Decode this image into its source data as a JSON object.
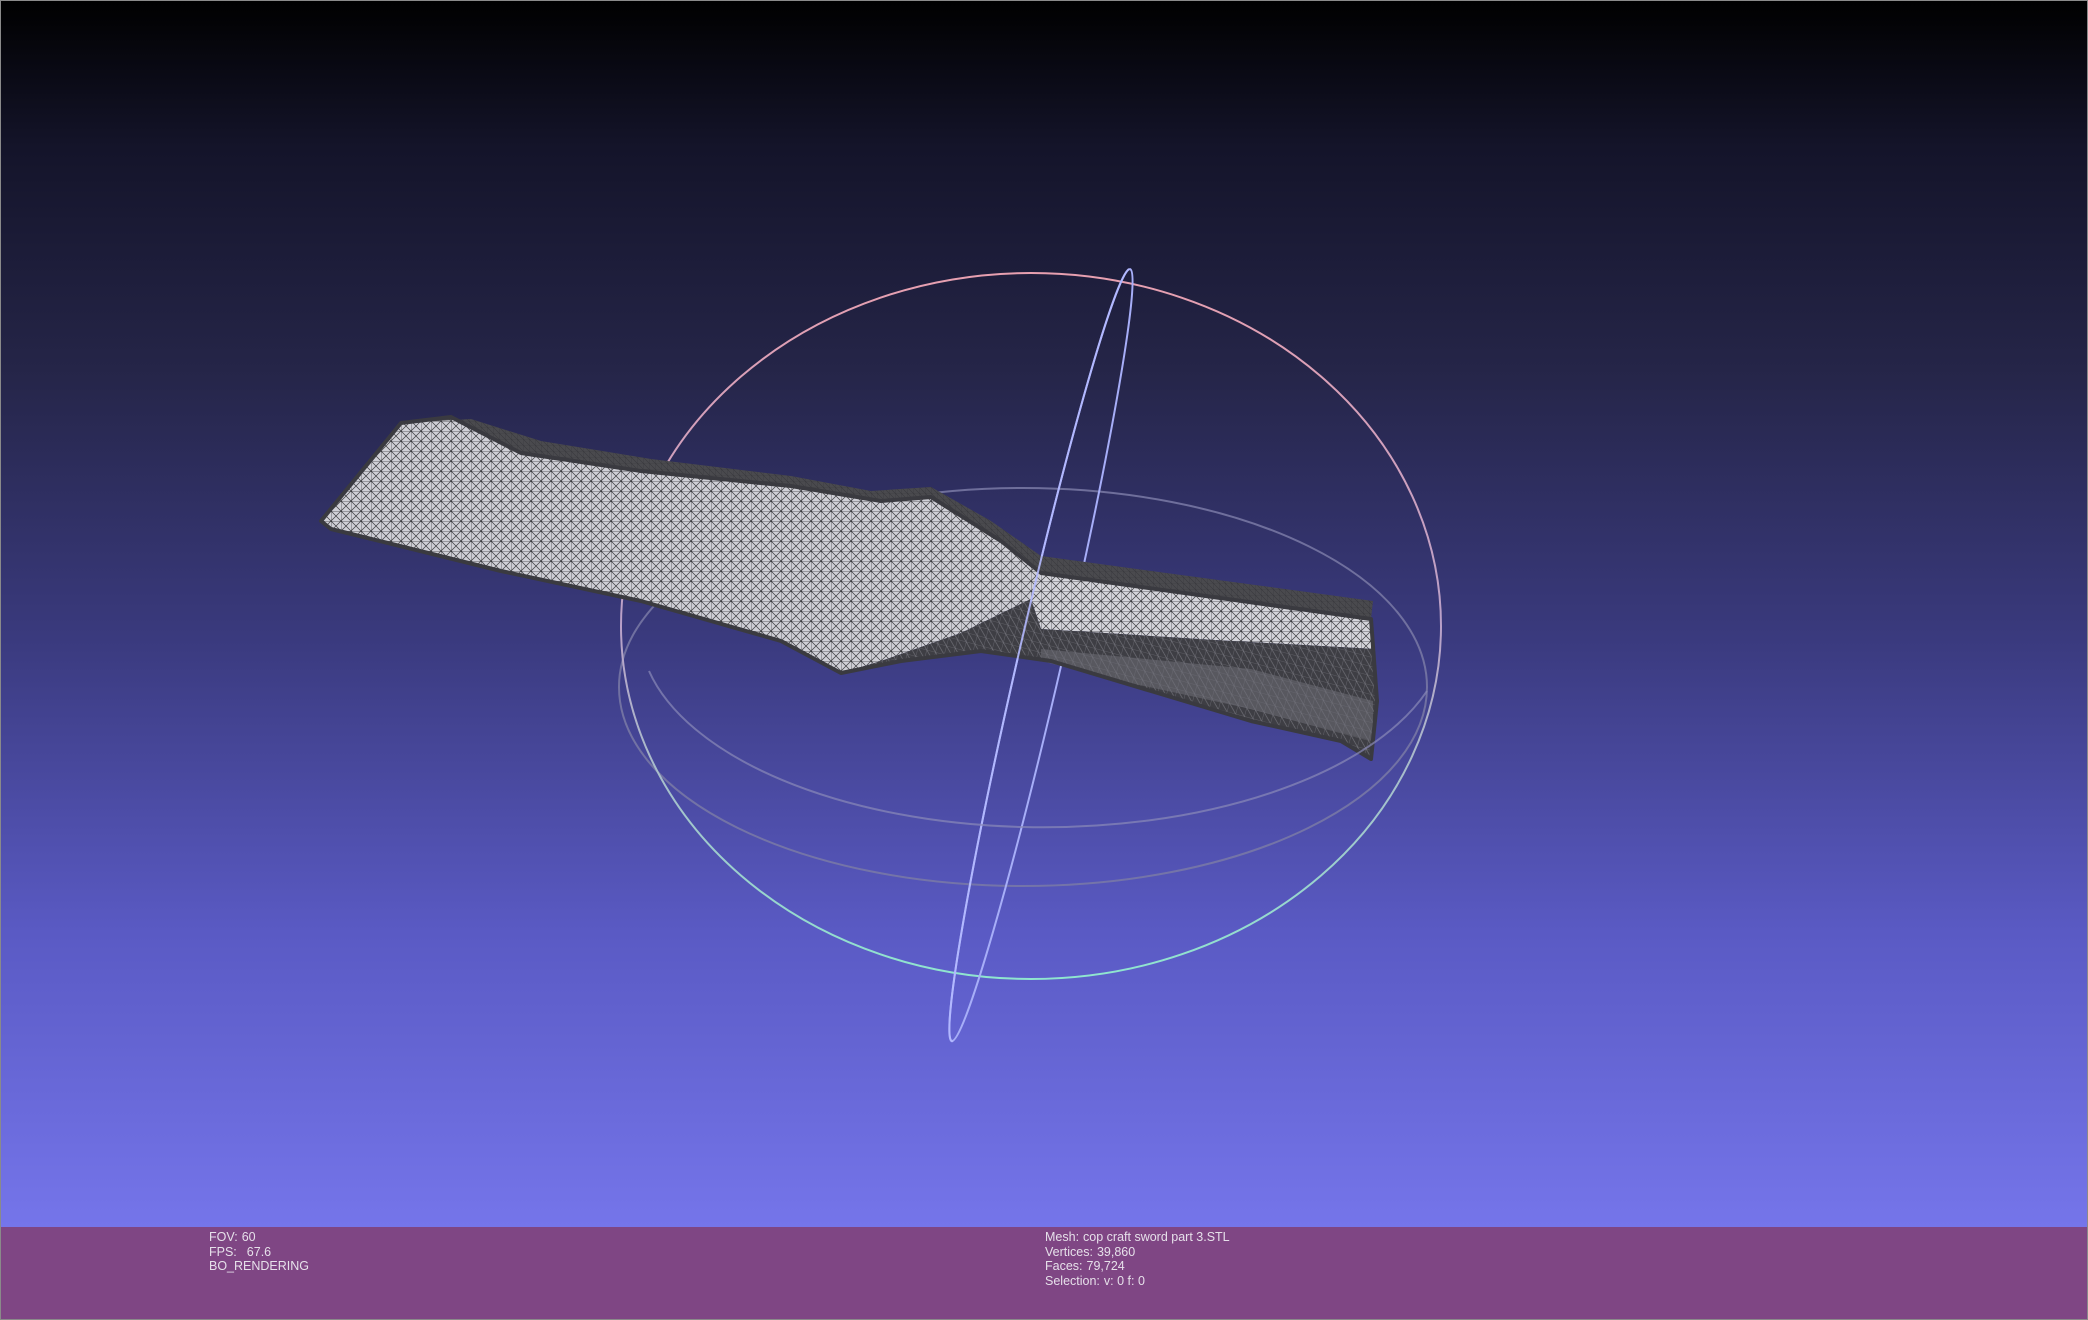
{
  "render_info": {
    "fov_label": "FOV:",
    "fov_value": "60",
    "fps_label": "FPS:",
    "fps_value": "67.6",
    "render_mode": "BO_RENDERING"
  },
  "mesh_info": {
    "mesh_label": "Mesh:",
    "mesh_name": "cop craft sword part 3.STL",
    "vertices_label": "Vertices:",
    "vertices_value": "39,860",
    "faces_label": "Faces:",
    "faces_value": "79,724",
    "selection_label": "Selection:",
    "selection_value": "v: 0 f: 0"
  },
  "colors": {
    "info_bar": "#7f4684",
    "background_top": "#000000",
    "background_bottom": "#7575ea",
    "mesh_fill": "#c9c9cf",
    "mesh_wire": "#2f2f33",
    "trackball_x": "#e8a0b0",
    "trackball_y": "#9fa6ff",
    "trackball_z": "#8fe6cf"
  },
  "icons": [
    "trackball-gizmo",
    "mesh-model"
  ]
}
